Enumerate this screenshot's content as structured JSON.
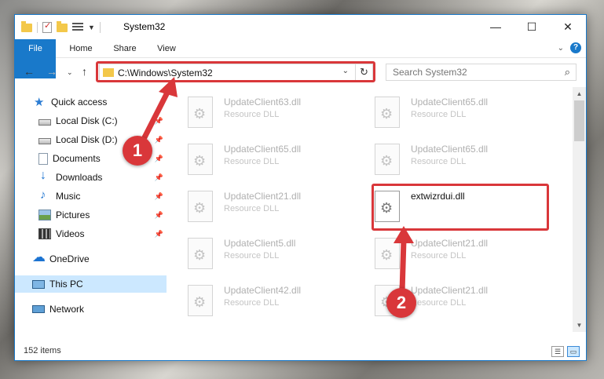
{
  "window": {
    "title": "System32",
    "controls": {
      "minimize": "—",
      "maximize": "☐",
      "close": "✕"
    }
  },
  "ribbon": {
    "tabs": [
      "File",
      "Home",
      "Share",
      "View"
    ],
    "help": "?"
  },
  "nav": {
    "address": "C:\\Windows\\System32",
    "search_placeholder": "Search System32"
  },
  "sidebar": {
    "items": [
      {
        "label": "Quick access",
        "icon": "star-icon"
      },
      {
        "label": "Local Disk (C:)",
        "icon": "drive-icon",
        "pinned": true
      },
      {
        "label": "Local Disk (D:)",
        "icon": "drive-icon",
        "pinned": true
      },
      {
        "label": "Documents",
        "icon": "documents-icon",
        "pinned": true
      },
      {
        "label": "Downloads",
        "icon": "download-icon",
        "pinned": true
      },
      {
        "label": "Music",
        "icon": "music-icon",
        "pinned": true
      },
      {
        "label": "Pictures",
        "icon": "pictures-icon",
        "pinned": true
      },
      {
        "label": "Videos",
        "icon": "videos-icon",
        "pinned": true
      },
      {
        "label": "OneDrive",
        "icon": "cloud-icon"
      },
      {
        "label": "This PC",
        "icon": "computer-icon",
        "selected": true
      },
      {
        "label": "Network",
        "icon": "network-icon"
      }
    ]
  },
  "files": [
    {
      "name": "UpdateClient63.dll",
      "type": "Resource DLL"
    },
    {
      "name": "UpdateClient65.dll",
      "type": "Resource DLL"
    },
    {
      "name": "UpdateClient65.dll",
      "type": "Resource DLL"
    },
    {
      "name": "UpdateClient65.dll",
      "type": "Resource DLL"
    },
    {
      "name": "UpdateClient21.dll",
      "type": "Resource DLL"
    },
    {
      "name": "extwizrdui.dll",
      "type": ""
    },
    {
      "name": "UpdateClient5.dll",
      "type": "Resource DLL"
    },
    {
      "name": "UpdateClient21.dll",
      "type": "Resource DLL"
    },
    {
      "name": "UpdateClient42.dll",
      "type": "Resource DLL"
    },
    {
      "name": "UpdateClient21.dll",
      "type": "Resource DLL"
    }
  ],
  "status": {
    "item_count": "152 items"
  },
  "annotations": {
    "step1": "1",
    "step2": "2",
    "color": "#d9373a"
  }
}
